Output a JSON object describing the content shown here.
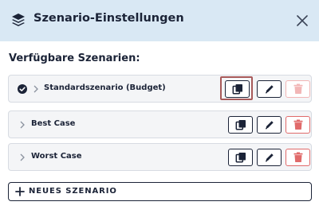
{
  "header": {
    "title": "Szenario-Einstellungen",
    "icon": "layers-icon",
    "close_icon": "close-icon"
  },
  "section_label": "Verfügbare Szenarien:",
  "scenarios": [
    {
      "name": "Standardszenario (Budget)",
      "active": true,
      "delete_disabled": true
    },
    {
      "name": "Best Case",
      "active": false,
      "delete_disabled": false
    },
    {
      "name": "Worst Case",
      "active": false,
      "delete_disabled": false
    }
  ],
  "row_actions": {
    "copy_icon": "copy-icon",
    "edit_icon": "pencil-icon",
    "delete_icon": "trash-icon"
  },
  "new_scenario_label": "NEUES SZENARIO",
  "colors": {
    "header_bg": "#d9e8f4",
    "text": "#1b2337",
    "row_bg": "#f4f5f7",
    "delete": "#e06a6a",
    "delete_disabled": "#f2b6b6",
    "highlight": "#a85a5a"
  }
}
